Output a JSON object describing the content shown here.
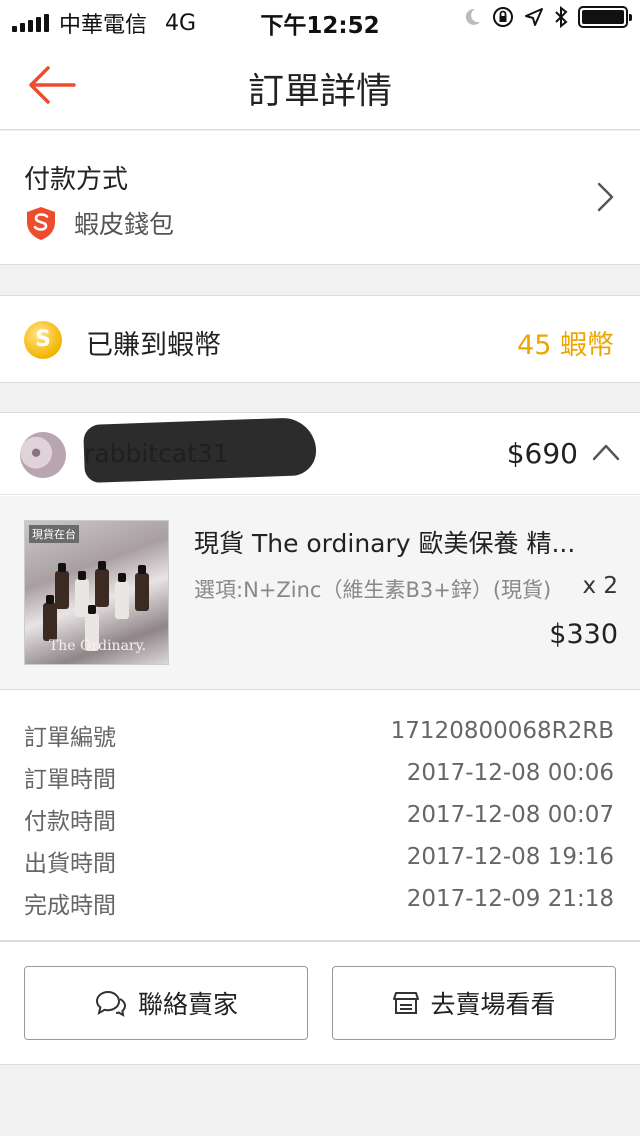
{
  "status_bar": {
    "carrier": "中華電信",
    "network": "4G",
    "time": "下午12:52"
  },
  "header": {
    "title": "訂單詳情",
    "back_icon": "arrow-left-icon",
    "accent_color": "#ee4d2d"
  },
  "payment": {
    "label": "付款方式",
    "method": "蝦皮錢包",
    "icon": "shopee-shield-icon"
  },
  "coins": {
    "label": "已賺到蝦幣",
    "value": "45 蝦幣",
    "coin_glyph": "S",
    "color": "#eda500"
  },
  "order": {
    "shop_name": "rabbitcat31",
    "total": "$690",
    "item": {
      "thumb_corner": "現貨在台",
      "thumb_label": "The Ordinary.",
      "title": "現貨 The ordinary 歐美保養 精...",
      "option": "選項:N+Zinc（維生素B3+鋅）(現貨)",
      "qty": "x 2",
      "price": "$330"
    }
  },
  "details": [
    {
      "key": "訂單編號",
      "value": "17120800068R2RB"
    },
    {
      "key": "訂單時間",
      "value": "2017-12-08 00:06"
    },
    {
      "key": "付款時間",
      "value": "2017-12-08 00:07"
    },
    {
      "key": "出貨時間",
      "value": "2017-12-08 19:16"
    },
    {
      "key": "完成時間",
      "value": "2017-12-09 21:18"
    }
  ],
  "actions": {
    "chat_label": "聯絡賣家",
    "shop_label": "去賣場看看"
  }
}
